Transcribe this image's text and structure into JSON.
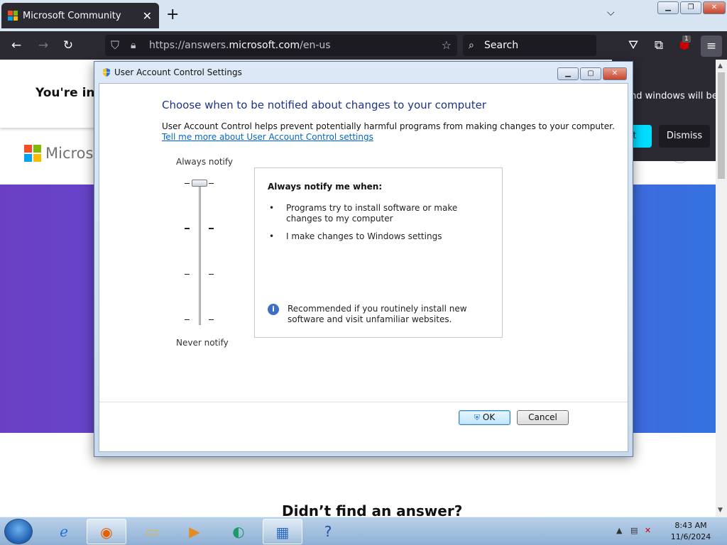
{
  "browser": {
    "tab_title": "Microsoft Community",
    "url_prefix": "https://answers.",
    "url_domain": "microsoft.com",
    "url_suffix": "/en-us",
    "search_placeholder": "Search",
    "extension_badge": "1"
  },
  "page": {
    "invite_text": "You're invi",
    "logo_text": "Microsof",
    "bottom_heading": "Didn’t find an answer?",
    "notice_text": "nd windows will be",
    "notice_action": "rt",
    "notice_dismiss": "Dismiss"
  },
  "uac": {
    "window_title": "User Account Control Settings",
    "heading": "Choose when to be notified about changes to your computer",
    "description": "User Account Control helps prevent potentially harmful programs from making changes to your computer.",
    "link": "Tell me more about User Account Control settings",
    "slider_top_label": "Always notify",
    "slider_bottom_label": "Never notify",
    "slider_level": "4 of 4 (top)",
    "box_title": "Always notify me when:",
    "bullets": [
      "Programs try to install software or make changes to my computer",
      "I make changes to Windows settings"
    ],
    "recommendation": "Recommended if you routinely install new software and visit unfamiliar websites.",
    "ok_label": "OK",
    "cancel_label": "Cancel"
  },
  "taskbar": {
    "time": "8:43 AM",
    "date": "11/6/2024"
  },
  "colors": {
    "browser_dark": "#2b2a33",
    "uac_heading": "#1e3287",
    "link": "#0066cc",
    "hero_purple": "#6b3fc4",
    "notice_button": "#00ddff"
  }
}
